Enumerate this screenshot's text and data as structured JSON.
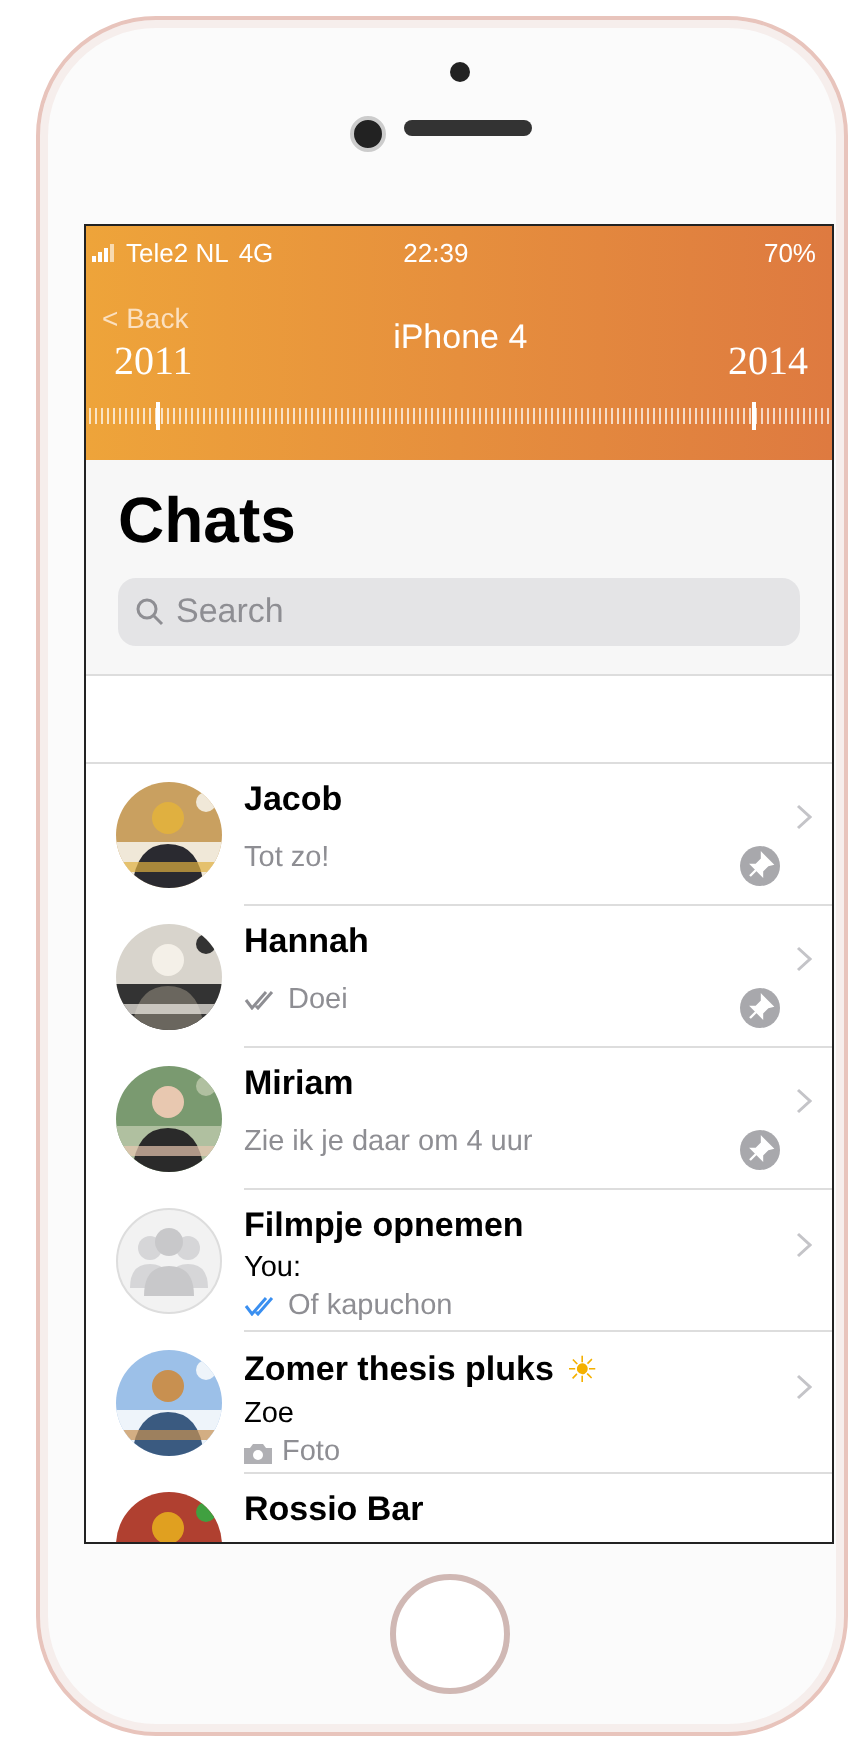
{
  "status_bar": {
    "carrier": "Tele2 NL",
    "network": "4G",
    "time": "22:39",
    "battery": "70%"
  },
  "header": {
    "back": "< Back",
    "title": "iPhone 4",
    "start_year": "2011",
    "end_year": "2014"
  },
  "title": "Chats",
  "search": {
    "placeholder": "Search"
  },
  "chats": [
    {
      "name": "Jacob",
      "avatar": {
        "kind": "picture"
      },
      "lines": [
        {
          "text": "Tot zo!",
          "kind": "message"
        }
      ],
      "pinned": true
    },
    {
      "name": "Hannah",
      "avatar": {
        "kind": "picture"
      },
      "lines": [
        {
          "text": "Doei",
          "kind": "delivered"
        }
      ],
      "pinned": true
    },
    {
      "name": "Miriam",
      "avatar": {
        "kind": "picture"
      },
      "lines": [
        {
          "text": "Zie ik je daar om 4 uur",
          "kind": "message"
        }
      ],
      "pinned": true
    },
    {
      "name": "Filmpje opnemen",
      "avatar": {
        "kind": "group"
      },
      "lines": [
        {
          "text": "You:",
          "kind": "sender"
        },
        {
          "text": "Of kapuchon",
          "kind": "read"
        }
      ],
      "pinned": false
    },
    {
      "name": "Zomer thesis pluks",
      "emoji": "☀",
      "avatar": {
        "kind": "picture"
      },
      "lines": [
        {
          "text": "Zoe",
          "kind": "sender"
        },
        {
          "text": "Foto"
        }
      ],
      "pinned": false
    },
    {
      "name": "Rossio Bar",
      "avatar": {
        "kind": "picture"
      },
      "pinned": false
    }
  ]
}
